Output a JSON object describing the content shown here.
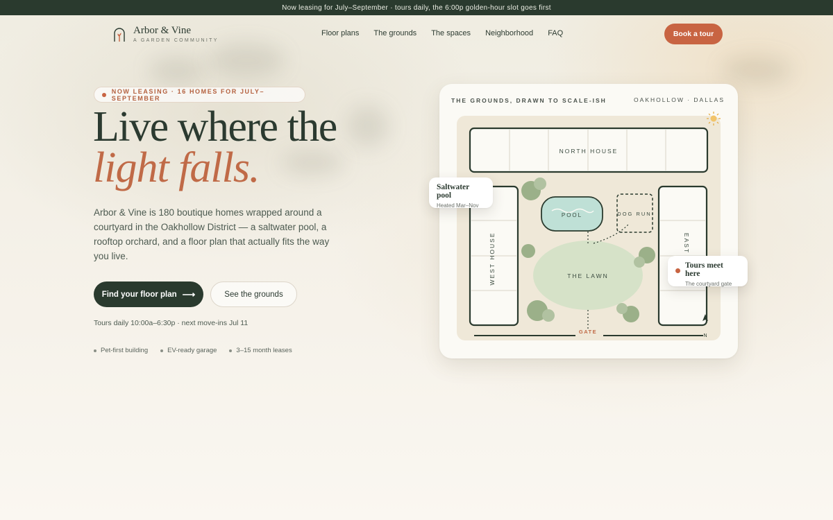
{
  "announcement": "Now leasing for July–September · tours daily, the 6:00p golden-hour slot goes first",
  "brand": {
    "name": "Arbor & Vine",
    "tagline": "A GARDEN COMMUNITY"
  },
  "nav": [
    "Floor plans",
    "The grounds",
    "The spaces",
    "Neighborhood",
    "FAQ"
  ],
  "cta_header": "Book a tour",
  "hero": {
    "badge": "NOW LEASING · 16 HOMES FOR JULY–SEPTEMBER",
    "headline_line1": "Live where the",
    "headline_line2": "light falls.",
    "lead": "Arbor & Vine is 180 boutique homes wrapped around a courtyard in the Oakhollow District — a saltwater pool, a rooftop orchard, and a floor plan that actually fits the way you live.",
    "primary_cta": "Find your floor plan",
    "secondary_cta": "See the grounds",
    "tours_info": "Tours daily 10:00a–6:30p · next move-ins Jul 11",
    "features": [
      "Pet-first building",
      "EV-ready garage",
      "3–15 month leases"
    ]
  },
  "map": {
    "title": "THE GROUNDS, DRAWN TO SCALE-ISH",
    "location": "OAKHOLLOW · DALLAS",
    "labels": {
      "north_house": "NORTH HOUSE",
      "west_house": "WEST HOUSE",
      "east_house": "EAST",
      "pool": "POOL",
      "dog_run": "DOG RUN",
      "lawn": "THE LAWN",
      "gate": "GATE",
      "north": "N"
    },
    "callouts": [
      {
        "title": "Saltwater pool",
        "subtitle": "Heated Mar–Nov"
      },
      {
        "title": "Tours meet here",
        "subtitle": "The courtyard gate"
      }
    ]
  },
  "colors": {
    "forest": "#2a3a2e",
    "terracotta": "#c86442",
    "lawn": "#d6e2c8",
    "pool": "#bfe0d6",
    "sand": "#efe8d8"
  }
}
